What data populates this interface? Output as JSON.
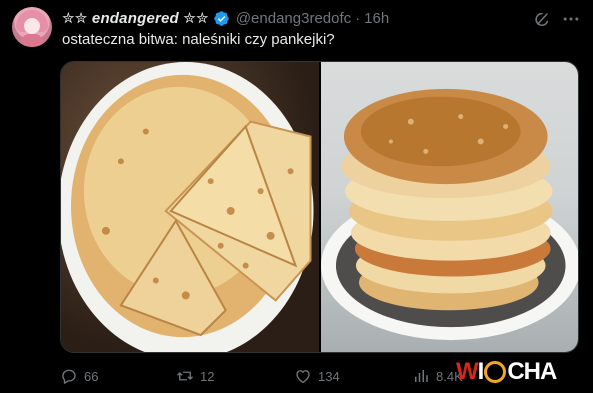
{
  "tweet": {
    "display_name": "✮✮ endangered ✮✮",
    "handle": "@endang3redofc",
    "separator": "·",
    "time": "16h",
    "text": "ostateczna bitwa: naleśniki czy pankejki?"
  },
  "stats": {
    "replies": "66",
    "reposts": "12",
    "likes": "134",
    "views": "8.4K"
  },
  "watermark": {
    "w": "W",
    "i": "I",
    "cha": "CHA"
  },
  "icons": {
    "verified": "verified-badge-icon",
    "grok": "grok-icon",
    "more": "more-icon",
    "reply": "reply-icon",
    "repost": "repost-icon",
    "like": "like-icon",
    "views": "views-icon"
  },
  "colors": {
    "background": "#000000",
    "text": "#e7e9ea",
    "muted": "#71767b",
    "verified": "#1d9bf0"
  }
}
